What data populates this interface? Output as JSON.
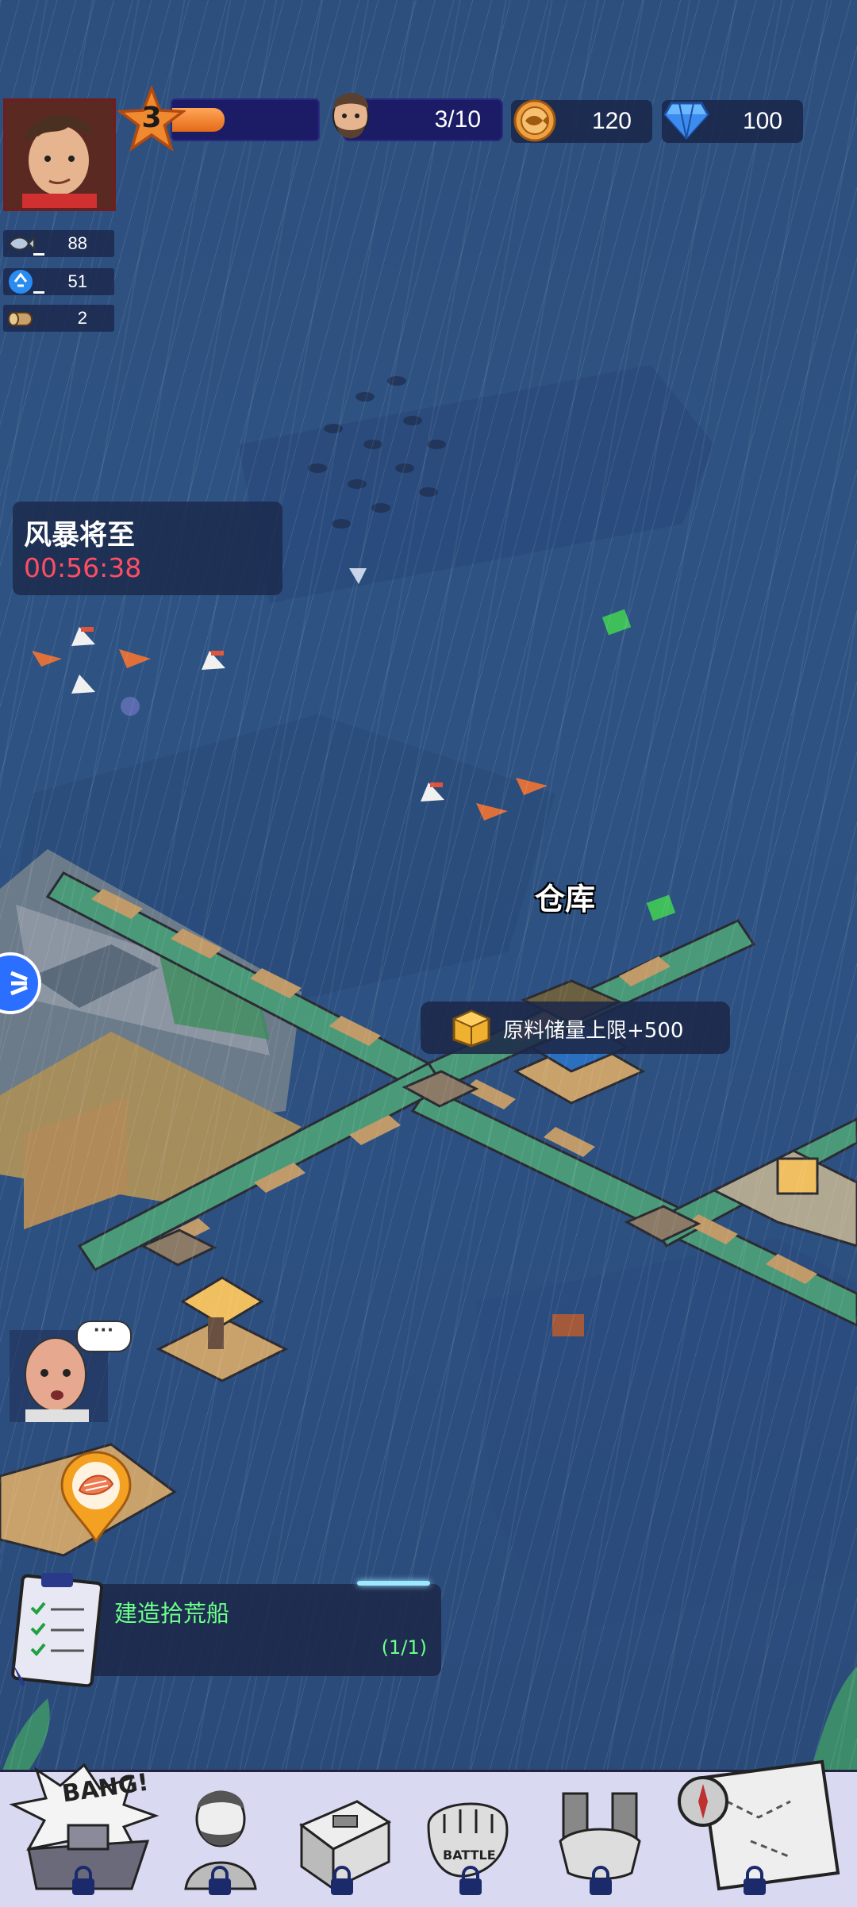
{
  "hud": {
    "level": "3",
    "xp_progress": 0.36,
    "survivors": "3/10",
    "coins": "120",
    "gems": "100",
    "resources": [
      {
        "icon": "fish-icon",
        "value": "88"
      },
      {
        "icon": "recycle-icon",
        "value": "51"
      },
      {
        "icon": "wood-log-icon",
        "value": "2"
      }
    ]
  },
  "storm_alert": {
    "title": "风暴将至",
    "countdown": "00:56:38",
    "countdown_color": "#ff4d63"
  },
  "map": {
    "warehouse_label": "仓库",
    "warehouse_bonus": "原料储量上限+500"
  },
  "npc": {
    "bubble": "···"
  },
  "task": {
    "title": "建造拾荒船",
    "progress": "(1/1)",
    "color": "#6dff8a"
  },
  "bottom_nav": [
    {
      "name": "battle-ship",
      "icon": "bang-ship-icon",
      "locked": true,
      "badge": "BANG!"
    },
    {
      "name": "hero",
      "icon": "survivor-hero-icon",
      "locked": true
    },
    {
      "name": "workshop",
      "icon": "toolbox-icon",
      "locked": true
    },
    {
      "name": "battle",
      "icon": "fist-battle-icon",
      "locked": true,
      "badge": "BATTLE"
    },
    {
      "name": "alliance",
      "icon": "handshake-icon",
      "locked": true
    },
    {
      "name": "map",
      "icon": "treasure-map-icon",
      "locked": true
    }
  ],
  "colors": {
    "sea": "#2e5383",
    "hud_panel": "#1b1b66",
    "xp": "#f08a30"
  }
}
